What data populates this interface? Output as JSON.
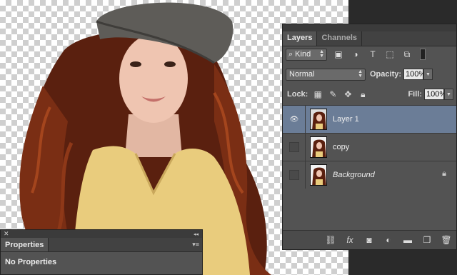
{
  "layers_panel": {
    "tabs": [
      {
        "label": "Layers"
      },
      {
        "label": "Channels"
      }
    ],
    "filter_kind": "Kind",
    "blend_mode": "Normal",
    "opacity_label": "Opacity:",
    "opacity_value": "100%",
    "lock_label": "Lock:",
    "fill_label": "Fill:",
    "fill_value": "100%",
    "layers": [
      {
        "name": "Layer 1",
        "visible": true,
        "selected": true
      },
      {
        "name": "copy",
        "visible": false,
        "selected": false
      },
      {
        "name": "Background",
        "visible": false,
        "selected": false,
        "locked": true
      }
    ],
    "filter_icons": [
      "image-filter-icon",
      "adjustment-filter-icon",
      "type-filter-icon",
      "shape-filter-icon",
      "smart-object-filter-icon"
    ],
    "lock_icons": [
      "lock-transparent-icon",
      "lock-image-icon",
      "lock-position-icon",
      "lock-all-icon"
    ],
    "bottom_icons": [
      "link-layers-icon",
      "fx-icon",
      "add-mask-icon",
      "adjustment-layer-icon",
      "new-group-icon",
      "new-layer-icon",
      "trash-icon"
    ]
  },
  "properties_panel": {
    "tab_label": "Properties",
    "body_text": "No Properties"
  },
  "colors": {
    "panel_bg": "#535353",
    "selected_row": "#6b7d97",
    "hair": "#6e2a14"
  }
}
